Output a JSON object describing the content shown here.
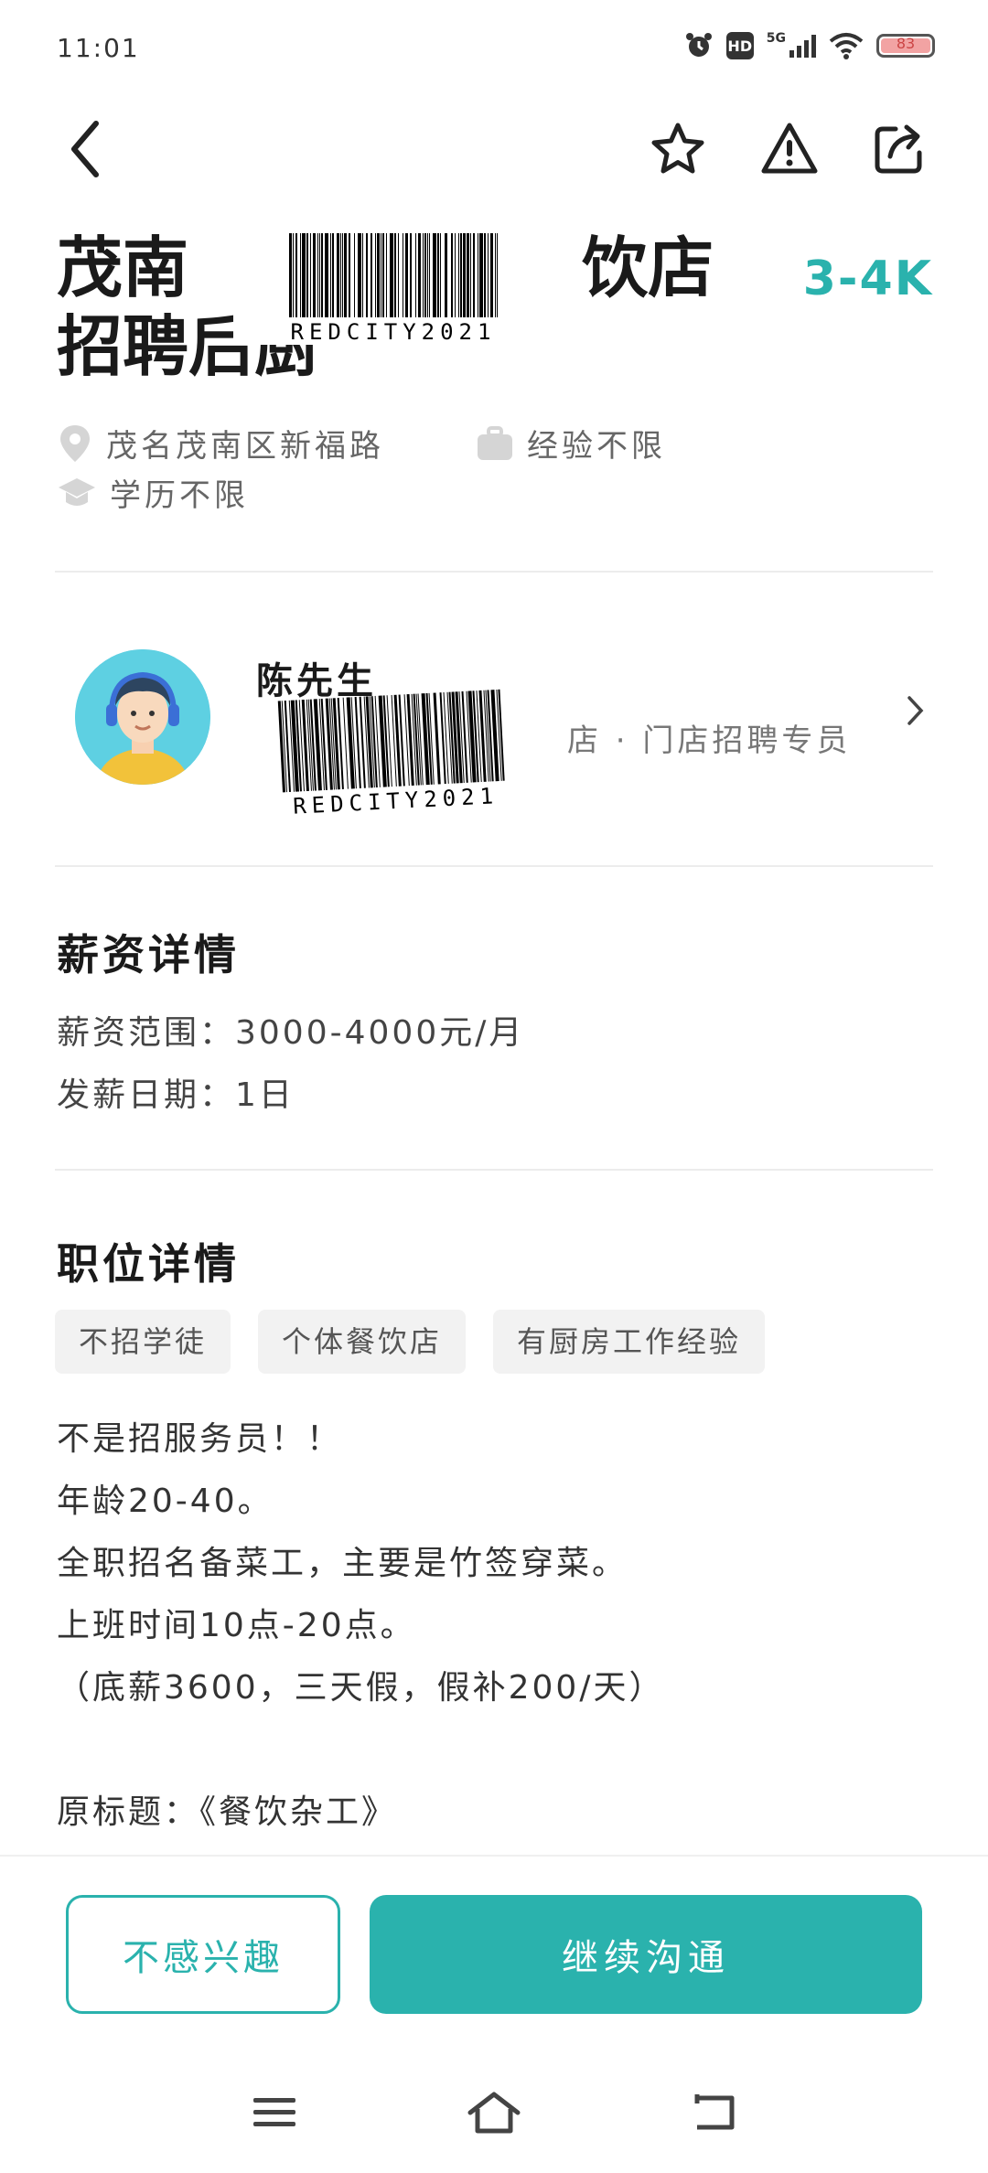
{
  "status_bar": {
    "time": "11:01",
    "alarm_icon": "alarm-clock-icon",
    "hd_label": "HD",
    "network_label": "5G",
    "wifi_icon": "wifi-icon",
    "battery_level": "83"
  },
  "nav": {
    "back_icon": "chevron-left-icon",
    "favorite_icon": "star-icon",
    "report_icon": "warning-icon",
    "share_icon": "share-icon"
  },
  "job": {
    "title_start": "茂南",
    "title_end": "饮店",
    "title_line2": "招聘后厨",
    "salary": "3-4K",
    "location": "茂名茂南区新福路",
    "experience": "经验不限",
    "education": "学历不限"
  },
  "watermark": {
    "code": "REDCITY2021"
  },
  "recruiter": {
    "name": "陈先生",
    "role_suffix": "店 · 门店招聘专员"
  },
  "salary_details": {
    "title": "薪资详情",
    "range": "薪资范围：3000-4000元/月",
    "payday": "发薪日期：1日"
  },
  "position_details": {
    "title": "职位详情",
    "tags": [
      "不招学徒",
      "个体餐饮店",
      "有厨房工作经验"
    ],
    "description": [
      "不是招服务员！！",
      "年龄20-40。",
      "全职招名备菜工，主要是竹签穿菜。",
      "上班时间10点-20点。",
      "（底薪3600，三天假，假补200/天）",
      "",
      "原标题：《餐饮杂工》"
    ]
  },
  "actions": {
    "not_interested": "不感兴趣",
    "continue_chat": "继续沟通"
  },
  "colors": {
    "accent": "#2ab2ad",
    "tag_bg": "#f2f2f2"
  }
}
